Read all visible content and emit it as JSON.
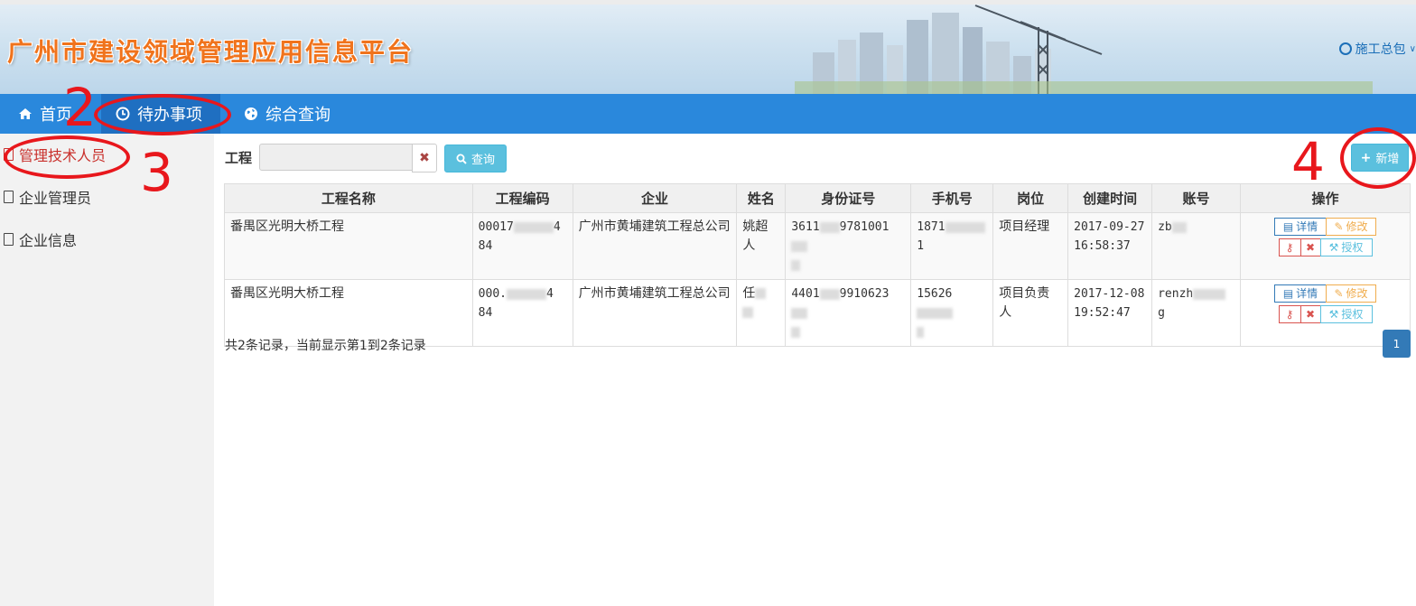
{
  "header": {
    "title": "广州市建设领域管理应用信息平台",
    "user_label": "施工总包"
  },
  "nav": {
    "items": [
      {
        "label": "首页",
        "icon": "home-icon"
      },
      {
        "label": "待办事项",
        "icon": "clock-icon"
      },
      {
        "label": "综合查询",
        "icon": "globe-icon"
      }
    ]
  },
  "sidebar": {
    "items": [
      {
        "label": "管理技术人员",
        "active": true
      },
      {
        "label": "企业管理员"
      },
      {
        "label": "企业信息"
      }
    ]
  },
  "search": {
    "label": "工程",
    "value": "",
    "query_label": "查询",
    "add_label": "新增"
  },
  "table": {
    "columns": [
      "工程名称",
      "工程编码",
      "企业",
      "姓名",
      "身份证号",
      "手机号",
      "岗位",
      "创建时间",
      "账号",
      "操作"
    ],
    "rows": [
      {
        "project": "番禺区光明大桥工程",
        "code_a": "00017",
        "code_b": "4",
        "code_c": "84",
        "company": "广州市黄埔建筑工程总公司",
        "name": "姚超人",
        "id_a": "3611",
        "id_b": "9781001",
        "phone_a": "1871",
        "phone_b": "1",
        "post": "项目经理",
        "created": "2017-09-27 16:58:37",
        "account": "zb"
      },
      {
        "project": "番禺区光明大桥工程",
        "code_a": "000.",
        "code_b": "4",
        "code_c": "84",
        "company": "广州市黄埔建筑工程总公司",
        "name": "任",
        "id_a": "4401",
        "id_b": "9910623",
        "phone_a": "15626",
        "phone_b": "",
        "post": "项目负责人",
        "created": "2017-12-08 19:52:47",
        "account": "renzh",
        "account_b": "g"
      }
    ],
    "op_labels": {
      "detail": "详情",
      "edit": "修改",
      "auth": "授权"
    }
  },
  "footer": {
    "info": "共2条记录，当前显示第1到2条记录",
    "page": "1"
  },
  "annotations": [
    "2",
    "3",
    "4"
  ],
  "colors": {
    "nav_bg": "#2a88dc",
    "nav_active": "#1f6fc1",
    "title_orange": "#f0731c",
    "annotation_red": "#e8171c",
    "info_btn": "#5bc0de"
  }
}
